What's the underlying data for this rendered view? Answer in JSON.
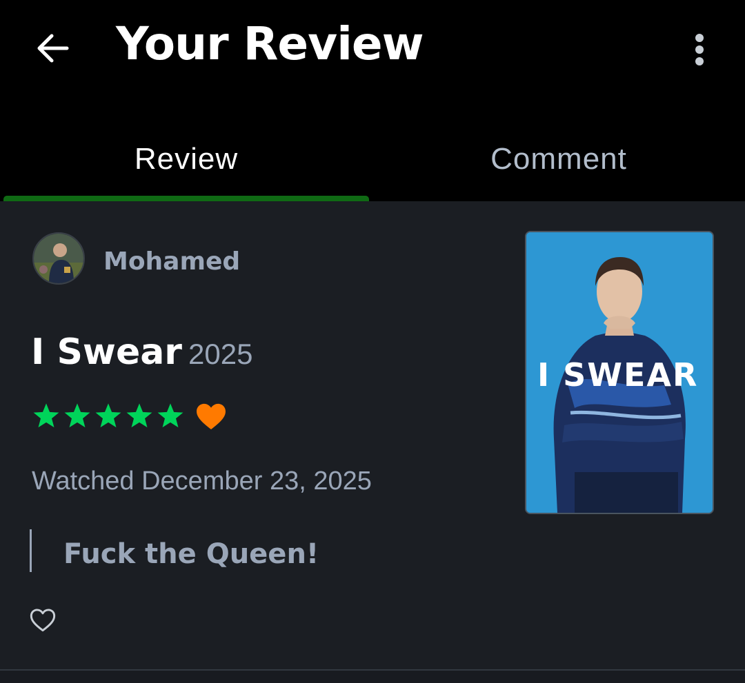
{
  "header": {
    "title": "Your Review",
    "back_icon": "arrow-left-icon",
    "menu_icon": "more-vertical-icon"
  },
  "tabs": [
    {
      "label": "Review",
      "active": true
    },
    {
      "label": "Comment",
      "active": false
    }
  ],
  "review": {
    "username": "Mohamed",
    "film_title": "I Swear",
    "film_year": "2025",
    "rating": {
      "stars": 5,
      "max": 5,
      "liked": true
    },
    "watched": "Watched December 23, 2025",
    "text": "Fuck the Queen!",
    "like_icon": "heart-outline-icon"
  },
  "poster": {
    "title": "I SWEAR"
  },
  "colors": {
    "background": "#1b1e23",
    "header_bg": "#000000",
    "tab_indicator": "#0f6a14",
    "star": "#00d45a",
    "heart": "#ff7a00",
    "muted_text": "#9aa6b8",
    "poster_bg": "#2d97d3"
  }
}
